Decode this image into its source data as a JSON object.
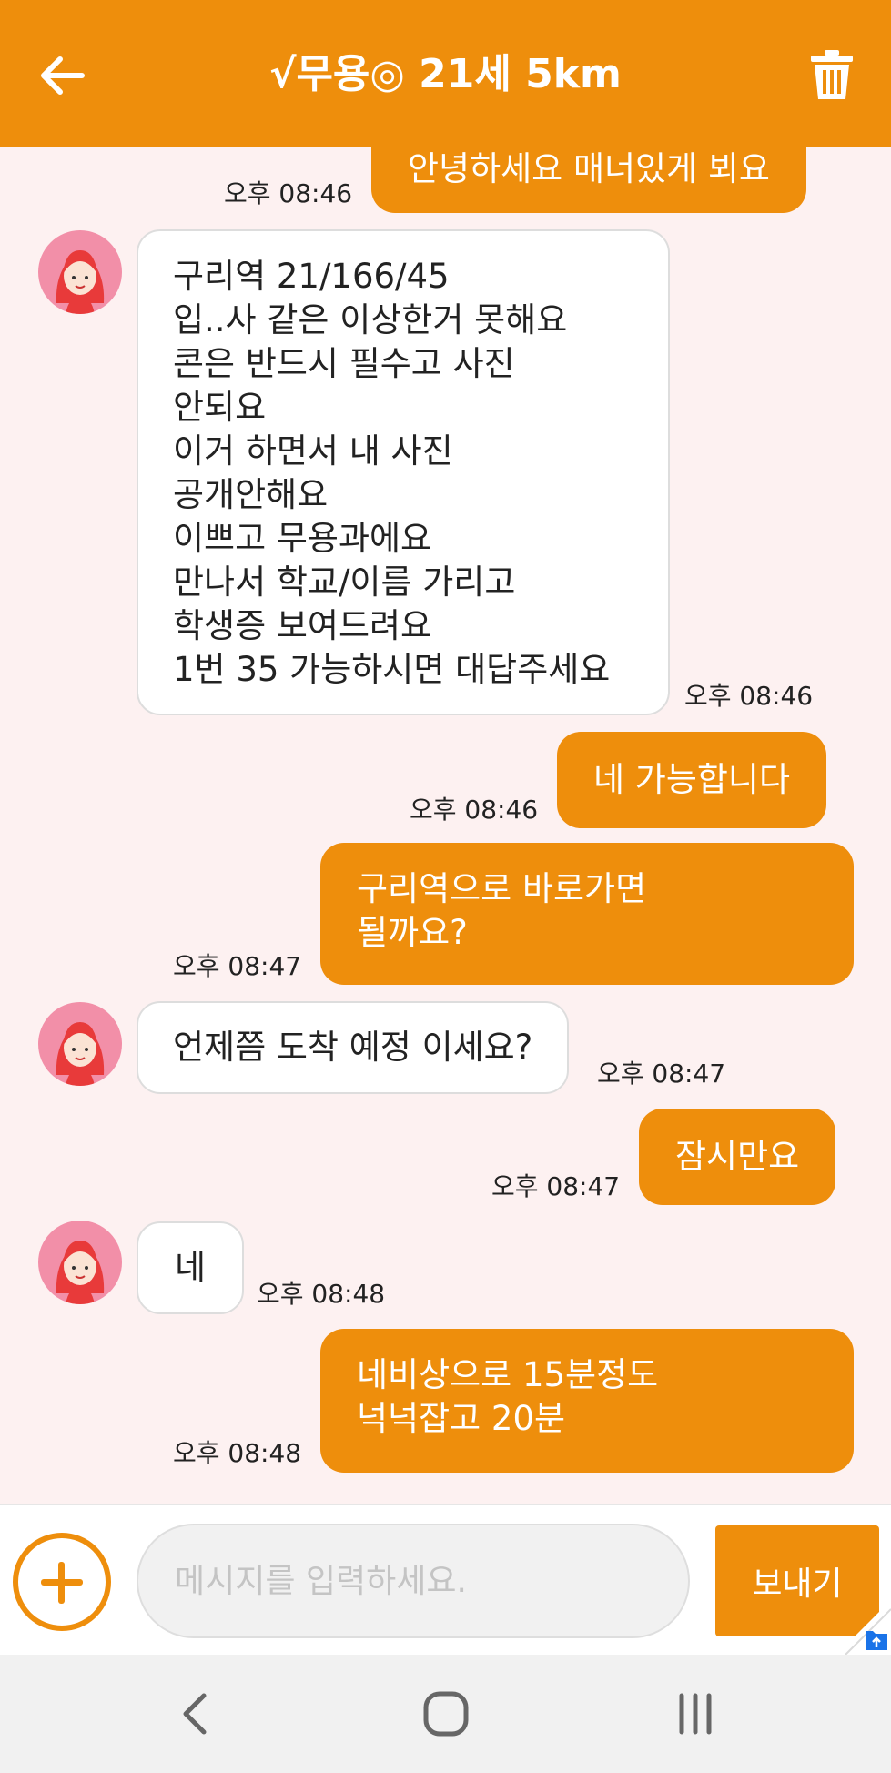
{
  "header": {
    "title": "√무용◎ 21세 5km",
    "back_icon": "arrow-left-icon",
    "delete_icon": "trash-icon",
    "background": "#ee8e0c"
  },
  "messages": [
    {
      "sender": "me",
      "text": "안녕하세요 매너있게 뵈요",
      "time": "오후 08:46"
    },
    {
      "sender": "them",
      "text": "구리역 21/166/45\n입..사 같은 이상한거 못해요\n콘은 반드시 필수고 사진\n안되요\n이거 하면서 내 사진\n공개안해요\n이쁘고 무용과에요\n만나서 학교/이름 가리고\n학생증 보여드려요\n1번 35 가능하시면 대답주세요",
      "time": "오후 08:46"
    },
    {
      "sender": "me",
      "text": "네 가능합니다",
      "time": "오후 08:46"
    },
    {
      "sender": "me",
      "text": "구리역으로 바로가면\n될까요?",
      "time": "오후 08:47"
    },
    {
      "sender": "them",
      "text": "언제쯤 도착 예정 이세요?",
      "time": "오후 08:47"
    },
    {
      "sender": "me",
      "text": "잠시만요",
      "time": "오후 08:47"
    },
    {
      "sender": "them",
      "text": "네",
      "time": "오후 08:48"
    },
    {
      "sender": "me",
      "text": "네비상으로 15분정도\n넉넉잡고 20분",
      "time": "오후 08:48"
    }
  ],
  "input": {
    "placeholder": "메시지를 입력하세요.",
    "value": "",
    "send_label": "보내기",
    "attach_icon": "plus-circle-icon"
  },
  "navbar": {
    "back_icon": "nav-back-icon",
    "home_icon": "nav-home-icon",
    "recents_icon": "nav-recents-icon"
  },
  "colors": {
    "accent": "#ee8e0c",
    "chat_background": "#fdf1f1",
    "avatar_background": "#f28fa8"
  }
}
